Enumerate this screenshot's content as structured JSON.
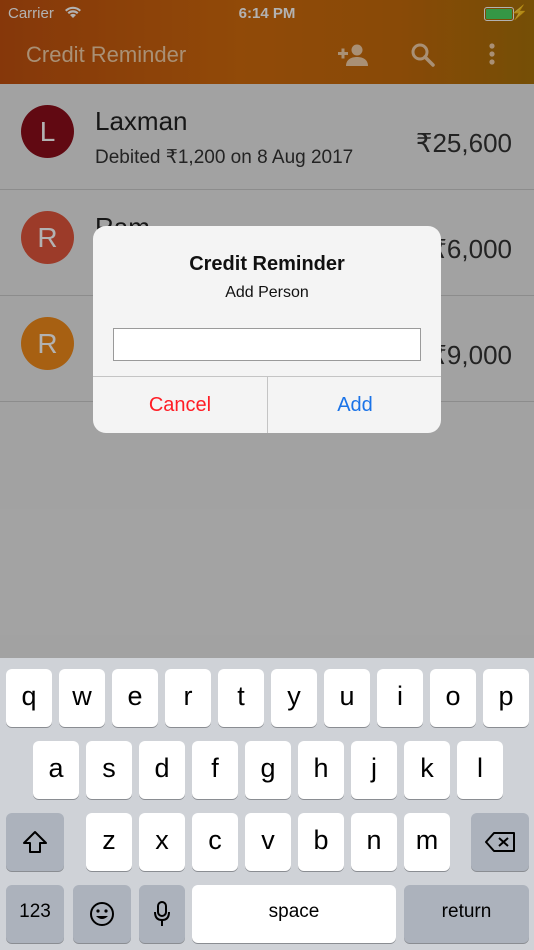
{
  "status_bar": {
    "carrier": "Carrier",
    "time": "6:14 PM",
    "wifi_icon": "wifi-icon",
    "battery_icon": "battery-icon",
    "charging_icon": "bolt-icon"
  },
  "app_bar": {
    "title": "Credit Reminder",
    "icons": [
      "add-person-icon",
      "search-icon",
      "more-vert-icon"
    ],
    "color": "#c85c0e"
  },
  "people": [
    {
      "initial": "L",
      "name": "Laxman",
      "detail": "Debited ₹1,200 on 8 Aug 2017",
      "amount": "₹25,600",
      "color": "#8b0e1a"
    },
    {
      "initial": "R",
      "name": "Ram",
      "detail": "",
      "amount": "₹6,000",
      "color": "#e0553c"
    },
    {
      "initial": "R",
      "name": "",
      "detail": "",
      "amount": "₹9,000",
      "color": "#ef8a1a"
    }
  ],
  "dialog": {
    "title": "Credit Reminder",
    "message": "Add Person",
    "input_value": "",
    "cancel_label": "Cancel",
    "add_label": "Add"
  },
  "keyboard": {
    "row1": [
      "q",
      "w",
      "e",
      "r",
      "t",
      "y",
      "u",
      "i",
      "o",
      "p"
    ],
    "row2": [
      "a",
      "s",
      "d",
      "f",
      "g",
      "h",
      "j",
      "k",
      "l"
    ],
    "row3": [
      "z",
      "x",
      "c",
      "v",
      "b",
      "n",
      "m"
    ],
    "numbers_label": "123",
    "space_label": "space",
    "return_label": "return",
    "icons": [
      "shift-icon",
      "backspace-icon",
      "emoji-icon",
      "microphone-icon"
    ]
  }
}
